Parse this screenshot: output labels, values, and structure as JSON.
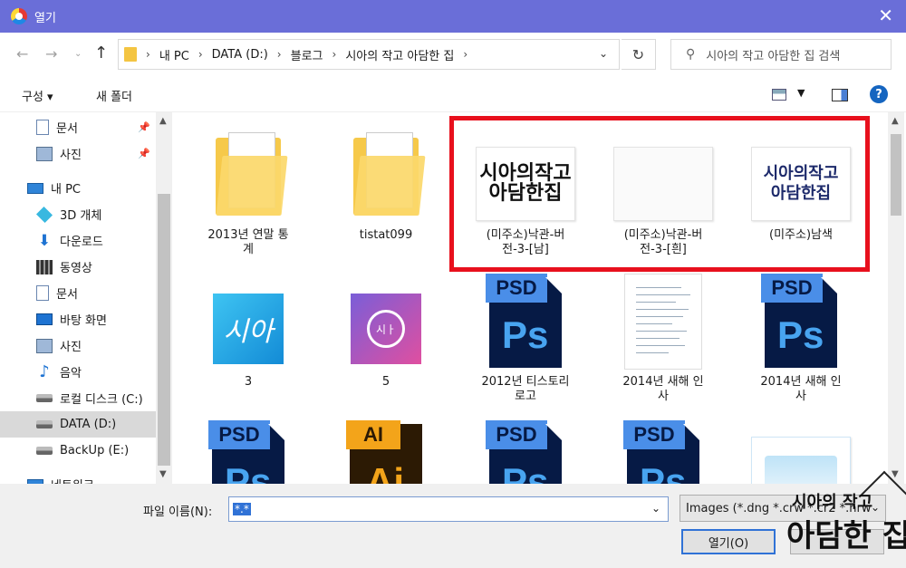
{
  "window": {
    "title": "열기",
    "close_icon": "close-icon"
  },
  "address": {
    "crumbs": [
      "내 PC",
      "DATA (D:)",
      "블로그",
      "시아의 작고 아담한 집"
    ],
    "search_placeholder": "시아의 작고 아담한 집 검색"
  },
  "toolbar": {
    "organize": "구성 ▾",
    "new_folder": "새 폴더"
  },
  "sidebar": {
    "items": [
      {
        "label": "문서",
        "icon": "document-icon",
        "pinned": true
      },
      {
        "label": "사진",
        "icon": "picture-icon",
        "pinned": true
      },
      {
        "label": "내 PC",
        "icon": "computer-icon"
      },
      {
        "label": "3D 개체",
        "icon": "cube-icon"
      },
      {
        "label": "다운로드",
        "icon": "download-icon"
      },
      {
        "label": "동영상",
        "icon": "video-icon"
      },
      {
        "label": "문서",
        "icon": "document-icon"
      },
      {
        "label": "바탕 화면",
        "icon": "desktop-icon"
      },
      {
        "label": "사진",
        "icon": "picture-icon"
      },
      {
        "label": "음악",
        "icon": "music-icon"
      },
      {
        "label": "로컬 디스크 (C:)",
        "icon": "drive-icon"
      },
      {
        "label": "DATA (D:)",
        "icon": "drive-icon",
        "selected": true
      },
      {
        "label": "BackUp (E:)",
        "icon": "drive-icon"
      },
      {
        "label": "네트워크",
        "icon": "network-icon"
      }
    ]
  },
  "files": {
    "row1": [
      {
        "label": "2013년 연말 통\n계",
        "type": "folder"
      },
      {
        "label": "tistat099",
        "type": "folder"
      },
      {
        "label": "(미주소)낙관-버\n전-3-[남]",
        "type": "image",
        "logo": "시아의작고\n아담한집"
      },
      {
        "label": "(미주소)낙관-버\n전-3-[흰]",
        "type": "image-white"
      },
      {
        "label": "(미주소)남색",
        "type": "image",
        "logo": "시아의작고\n아담한집"
      }
    ],
    "row2": [
      {
        "label": "3",
        "type": "blue-logo",
        "thumb_text": "시아"
      },
      {
        "label": "5",
        "type": "purple-logo",
        "thumb_text": "시ㅏ"
      },
      {
        "label": "2012년 티스토리\n로고",
        "type": "psd"
      },
      {
        "label": "2014년 새해 인\n사",
        "type": "document"
      },
      {
        "label": "2014년 새해 인\n사",
        "type": "psd"
      }
    ],
    "row3": [
      {
        "type": "psd"
      },
      {
        "type": "ai"
      },
      {
        "type": "psd"
      },
      {
        "type": "psd"
      },
      {
        "type": "image-logo"
      }
    ],
    "psd_badge": "PSD",
    "psd_glyph": "Ps",
    "ai_badge": "AI",
    "ai_glyph": "Ai"
  },
  "bottom": {
    "filename_label": "파일 이름(N):",
    "filename_value": "*.*",
    "filter_value": "Images (*.dng *.crw *.cr2 *.nrw",
    "open_label": "열기(O)"
  },
  "watermark": {
    "line1": "시아의 작고",
    "line2": "아담한 집"
  },
  "colors": {
    "titlebar": "#6a6ed8",
    "highlight": "#e8101d",
    "accent": "#3072d6"
  }
}
